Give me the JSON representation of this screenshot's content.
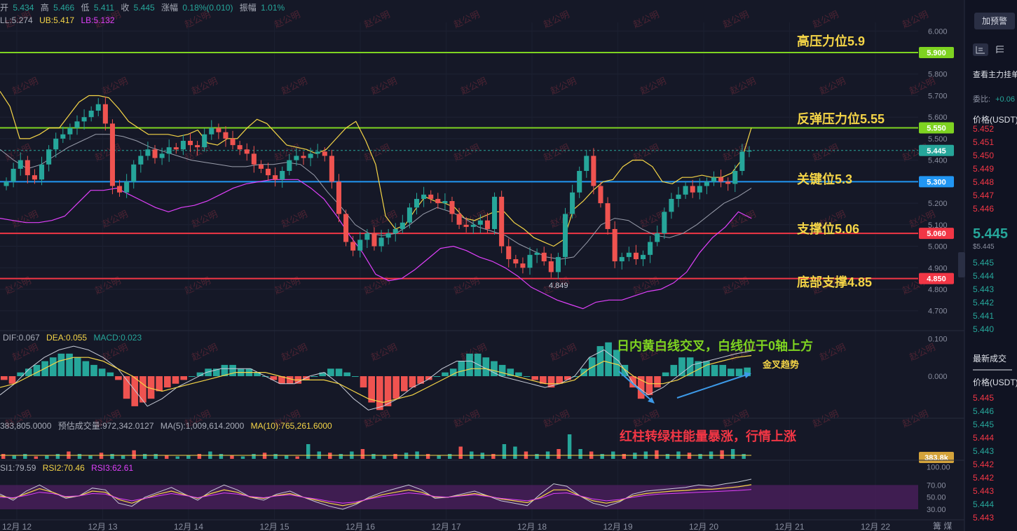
{
  "ohlc_bar": {
    "open_label": "开",
    "open": "5.434",
    "high_label": "高",
    "high": "5.466",
    "low_label": "低",
    "low": "5.411",
    "close_label": "收",
    "close": "5.445",
    "change_label": "涨幅",
    "change": "0.18%(0.010)",
    "amp_label": "振幅",
    "amp": "1.01%"
  },
  "boll_bar": {
    "mid": "LL:5.274",
    "ub": "UB:5.417",
    "lb": "LB:5.132"
  },
  "macd_bar": {
    "dif": "DIF:0.067",
    "dea": "DEA:0.055",
    "macd": "MACD:0.023"
  },
  "vol_bar": {
    "vol": "383,805.0000",
    "est": "预估成交量:972,342.0127",
    "ma5": "MA(5):1,009,614.2000",
    "ma10": "MA(10):765,261.6000"
  },
  "rsi_bar": {
    "rsi1": "SI1:79.59",
    "rsi2": "RSI2:70.46",
    "rsi3": "RSI3:62.61"
  },
  "watermark": "赵公明",
  "annotations": {
    "high_resist": "高压力位5.9",
    "rebound_resist": "反弹压力位5.55",
    "key_level": "关键位5.3",
    "support": "支撑位5.06",
    "bottom_support": "底部支撑4.85",
    "macd_note": "日内黄白线交叉，白线位于0轴上方",
    "golden_cross": "金叉趋势",
    "vol_note": "红柱转绿柱能量暴涨，行情上涨",
    "low_marker": "4.849"
  },
  "colors": {
    "up": "#26a69a",
    "down": "#ef5350",
    "green_line": "#7ed321",
    "blue_line": "#2196f3",
    "red_line": "#f23645",
    "yellow": "#f5d547",
    "pink": "#e040fb",
    "annot": "#f5d547"
  },
  "chart_data": [
    {
      "type": "candlestick",
      "title": "",
      "x_ticks": [
        "12月 12",
        "12月 13",
        "12月 14",
        "12月 15",
        "12月 16",
        "12月 17",
        "12月 18",
        "12月 19",
        "12月 20",
        "12月 21",
        "12月 22"
      ],
      "x_tail": "篝  煤",
      "y_ticks": [
        "6.000",
        "5.900",
        "5.800",
        "5.700",
        "5.600",
        "5.500",
        "5.400",
        "5.300",
        "5.200",
        "5.100",
        "5.000",
        "4.900",
        "4.800",
        "4.700"
      ],
      "ylim": [
        4.66,
        6.04
      ],
      "levels": [
        {
          "value": 5.9,
          "label": "5.900",
          "color": "green"
        },
        {
          "value": 5.55,
          "label": "5.550",
          "color": "green"
        },
        {
          "value": 5.445,
          "label": "5.445",
          "color": "current"
        },
        {
          "value": 5.3,
          "label": "5.300",
          "color": "blue"
        },
        {
          "value": 5.06,
          "label": "5.060",
          "color": "red"
        },
        {
          "value": 4.85,
          "label": "4.850",
          "color": "red"
        }
      ],
      "close_series": [
        5.3,
        5.36,
        5.4,
        5.33,
        5.31,
        5.38,
        5.45,
        5.5,
        5.52,
        5.55,
        5.58,
        5.6,
        5.63,
        5.66,
        5.57,
        5.28,
        5.25,
        5.3,
        5.38,
        5.42,
        5.45,
        5.41,
        5.43,
        5.46,
        5.45,
        5.49,
        5.47,
        5.46,
        5.52,
        5.55,
        5.53,
        5.5,
        5.47,
        5.45,
        5.43,
        5.38,
        5.36,
        5.33,
        5.31,
        5.35,
        5.4,
        5.42,
        5.41,
        5.43,
        5.44,
        5.42,
        5.3,
        5.15,
        5.02,
        4.98,
        5.03,
        5.06,
        5.0,
        5.04,
        5.06,
        5.08,
        5.11,
        5.18,
        5.22,
        5.24,
        5.22,
        5.2,
        5.21,
        5.15,
        5.1,
        5.09,
        5.1,
        5.12,
        5.08,
        5.23,
        5.0,
        4.94,
        4.92,
        4.9,
        4.96,
        4.97,
        4.93,
        4.88,
        4.95,
        5.15,
        5.25,
        5.35,
        5.42,
        5.28,
        5.2,
        5.08,
        4.93,
        4.95,
        4.97,
        4.94,
        4.96,
        5.02,
        5.06,
        5.16,
        5.22,
        5.24,
        5.28,
        5.25,
        5.28,
        5.3,
        5.32,
        5.3,
        5.29,
        5.35,
        5.44,
        5.445
      ],
      "boll_ub": [
        5.72,
        5.65,
        5.5,
        5.5,
        5.52,
        5.55,
        5.55,
        5.61,
        5.67,
        5.7,
        5.7,
        5.69,
        5.64,
        5.58,
        5.55,
        5.52,
        5.52,
        5.52,
        5.51,
        5.52,
        5.54,
        5.48,
        5.47,
        5.5,
        5.5,
        5.55,
        5.59,
        5.57,
        5.52,
        5.47,
        5.46,
        5.45,
        5.43,
        5.45,
        5.5,
        5.55,
        5.58,
        5.49,
        5.38,
        5.14,
        5.08,
        5.1,
        5.17,
        5.23,
        5.21,
        5.2,
        5.18,
        5.13,
        5.12,
        5.14,
        5.16,
        5.16,
        5.11,
        5.08,
        5.04,
        5.02,
        5.0,
        5.03,
        5.17,
        5.21,
        5.26,
        5.3,
        5.31,
        5.37,
        5.4,
        5.4,
        5.37,
        5.3,
        5.29,
        5.32,
        5.32,
        5.33,
        5.32,
        5.32,
        5.34,
        5.4,
        5.55
      ],
      "boll_lb": [
        5.13,
        5.12,
        5.11,
        5.11,
        5.12,
        5.14,
        5.2,
        5.26,
        5.26,
        5.27,
        5.24,
        5.21,
        5.18,
        5.16,
        5.18,
        5.19,
        5.21,
        5.24,
        5.27,
        5.29,
        5.3,
        5.31,
        5.31,
        5.31,
        5.27,
        5.22,
        5.14,
        5.05,
        4.97,
        4.87,
        4.84,
        4.85,
        4.89,
        4.94,
        4.99,
        5.0,
        4.98,
        4.95,
        4.93,
        4.9,
        4.86,
        4.81,
        4.78,
        4.75,
        4.73,
        4.71,
        4.74,
        4.75,
        4.75,
        4.77,
        4.79,
        4.8,
        4.83,
        4.88,
        4.97,
        5.04,
        5.09,
        5.16,
        5.13
      ],
      "boll_mid": [
        5.45,
        5.4,
        5.36,
        5.38,
        5.42,
        5.46,
        5.49,
        5.52,
        5.52,
        5.51,
        5.49,
        5.46,
        5.44,
        5.42,
        5.4,
        5.39,
        5.38,
        5.37,
        5.37,
        5.38,
        5.38,
        5.39,
        5.38,
        5.33,
        5.25,
        5.18,
        5.1,
        5.06,
        5.05,
        5.06,
        5.1,
        5.15,
        5.18,
        5.16,
        5.13,
        5.09,
        5.07,
        5.05,
        5.01,
        4.98,
        4.95,
        4.94,
        4.95,
        5.02,
        5.1,
        5.13,
        5.12,
        5.08,
        5.05,
        5.04,
        5.06,
        5.1,
        5.15,
        5.2,
        5.23,
        5.27
      ]
    },
    {
      "type": "bar",
      "title": "MACD",
      "y_ticks": [
        "0.100",
        "0.000"
      ],
      "ylim": [
        -0.11,
        0.11
      ],
      "values": [
        -0.01,
        -0.02,
        0.01,
        0.02,
        0.03,
        0.04,
        0.05,
        0.06,
        0.06,
        0.05,
        0.04,
        0.03,
        0.02,
        0.01,
        -0.01,
        -0.06,
        -0.08,
        -0.07,
        -0.06,
        -0.04,
        -0.03,
        -0.02,
        -0.01,
        0.0,
        0.01,
        0.02,
        0.02,
        0.03,
        0.03,
        0.02,
        0.02,
        0.01,
        0.0,
        -0.01,
        -0.02,
        -0.02,
        -0.02,
        -0.01,
        0.0,
        0.01,
        0.02,
        0.02,
        0.01,
        0.0,
        -0.03,
        -0.07,
        -0.09,
        -0.08,
        -0.06,
        -0.04,
        -0.03,
        -0.02,
        -0.01,
        0.0,
        0.01,
        0.02,
        0.04,
        0.06,
        0.06,
        0.05,
        0.04,
        0.03,
        0.02,
        0.01,
        0.0,
        -0.01,
        -0.02,
        -0.03,
        -0.02,
        -0.01,
        0.0,
        0.02,
        0.05,
        0.08,
        0.09,
        0.07,
        0.03,
        -0.03,
        -0.06,
        -0.05,
        -0.03,
        0.01,
        0.03,
        0.05,
        0.05,
        0.04,
        0.04,
        0.03,
        0.03,
        0.02,
        0.02,
        0.023
      ],
      "dif": [
        -0.05,
        -0.02,
        0.02,
        0.05,
        0.07,
        0.08,
        0.07,
        0.05,
        0.02,
        -0.03,
        -0.08,
        -0.06,
        -0.03,
        -0.01,
        0.01,
        0.02,
        0.02,
        0.02,
        0.0,
        -0.02,
        -0.02,
        0.0,
        0.01,
        -0.02,
        -0.06,
        -0.09,
        -0.08,
        -0.06,
        -0.03,
        -0.01,
        0.02,
        0.04,
        0.04,
        0.02,
        0.0,
        -0.01,
        -0.02,
        -0.03,
        -0.02,
        0.0,
        0.05,
        0.07,
        0.04,
        -0.02,
        -0.05,
        -0.03,
        0.0,
        0.03,
        0.04,
        0.05,
        0.06,
        0.067
      ],
      "dea": [
        -0.03,
        -0.02,
        0.0,
        0.02,
        0.04,
        0.05,
        0.05,
        0.04,
        0.02,
        0.0,
        -0.03,
        -0.04,
        -0.03,
        -0.02,
        -0.01,
        0.0,
        0.01,
        0.01,
        0.01,
        0.0,
        -0.01,
        -0.01,
        -0.01,
        -0.02,
        -0.04,
        -0.06,
        -0.07,
        -0.06,
        -0.05,
        -0.03,
        -0.01,
        0.01,
        0.02,
        0.02,
        0.01,
        0.0,
        -0.01,
        -0.02,
        -0.02,
        -0.01,
        0.02,
        0.04,
        0.03,
        0.0,
        -0.02,
        -0.02,
        -0.01,
        0.01,
        0.03,
        0.04,
        0.05,
        0.055
      ]
    },
    {
      "type": "bar",
      "title": "Volume",
      "current_label": "383.8k",
      "values": [
        0.2,
        0.15,
        0.2,
        0.1,
        0.15,
        0.2,
        0.3,
        0.2,
        0.15,
        0.25,
        0.2,
        0.15,
        0.35,
        0.2,
        0.2,
        0.15,
        0.1,
        0.15,
        0.2,
        0.3,
        0.2,
        0.15,
        0.1,
        0.2,
        0.25,
        0.2,
        0.15,
        0.1,
        0.6,
        0.3,
        0.25,
        0.2,
        0.3,
        0.4,
        0.2,
        0.15,
        0.2,
        0.25,
        0.3,
        0.2,
        0.15,
        0.2,
        0.5,
        0.3,
        0.25,
        0.2,
        0.6,
        0.5,
        0.3,
        0.2,
        0.3,
        0.4,
        1.0,
        0.4,
        0.3,
        0.2,
        0.3,
        0.2,
        0.25,
        0.3,
        0.35,
        0.2,
        0.3,
        0.25,
        0.2,
        0.3,
        0.35,
        0.4,
        0.2
      ]
    },
    {
      "type": "line",
      "title": "RSI",
      "y_ticks": [
        "100.00",
        "70.00",
        "50.00",
        "30.00"
      ],
      "ylim": [
        15,
        105
      ],
      "rsi1": [
        55,
        45,
        60,
        70,
        58,
        48,
        52,
        65,
        62,
        40,
        35,
        50,
        58,
        66,
        55,
        45,
        60,
        70,
        62,
        50,
        45,
        55,
        60,
        50,
        42,
        35,
        30,
        38,
        50,
        58,
        64,
        70,
        62,
        48,
        50,
        55,
        60,
        52,
        44,
        40,
        36,
        55,
        72,
        68,
        52,
        40,
        35,
        42,
        55,
        60,
        62,
        64,
        66,
        70,
        68,
        72,
        75,
        79.59
      ],
      "rsi2": [
        52,
        48,
        56,
        64,
        58,
        50,
        52,
        60,
        58,
        46,
        40,
        48,
        55,
        60,
        54,
        48,
        56,
        62,
        58,
        50,
        48,
        53,
        56,
        50,
        45,
        40,
        36,
        40,
        48,
        54,
        58,
        62,
        58,
        50,
        50,
        53,
        56,
        52,
        47,
        44,
        41,
        50,
        62,
        62,
        52,
        44,
        40,
        44,
        52,
        56,
        58,
        60,
        61,
        63,
        63,
        65,
        67,
        70.46
      ],
      "rsi3": [
        50,
        49,
        53,
        58,
        56,
        51,
        52,
        56,
        55,
        48,
        44,
        48,
        52,
        56,
        53,
        49,
        53,
        57,
        55,
        51,
        49,
        52,
        54,
        50,
        47,
        43,
        40,
        42,
        47,
        51,
        54,
        57,
        55,
        51,
        50,
        52,
        54,
        51,
        48,
        46,
        44,
        48,
        56,
        57,
        52,
        47,
        44,
        46,
        50,
        53,
        55,
        56,
        57,
        58,
        59,
        60,
        61,
        62.61
      ]
    }
  ],
  "right_panel": {
    "button": "加预警",
    "header_link": "查看主力挂单",
    "commission": "委比:",
    "commission_val": "+0.06",
    "price_header": "价格(USDT)",
    "asks": [
      "5.452",
      "5.451",
      "5.450",
      "5.449",
      "5.448",
      "5.447",
      "5.446"
    ],
    "big_price": "5.445",
    "sub_price": "$5.445",
    "bids": [
      "5.445",
      "5.444",
      "5.443",
      "5.442",
      "5.441",
      "5.440"
    ],
    "trades_title": "最新成交",
    "trades_header": "价格(USDT)",
    "trades": [
      "5.445",
      "5.446",
      "5.445",
      "5.444",
      "5.443",
      "5.442",
      "5.442",
      "5.443",
      "5.444",
      "5.443"
    ]
  }
}
